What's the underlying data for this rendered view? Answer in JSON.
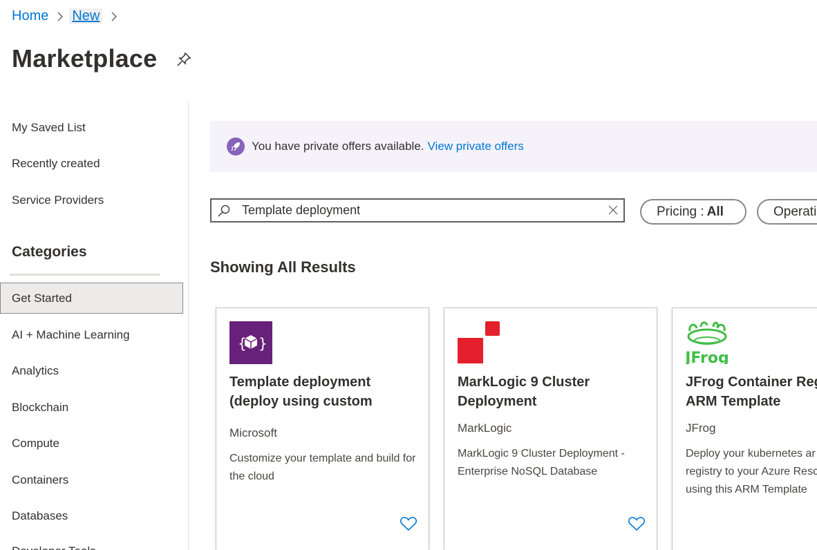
{
  "breadcrumb": {
    "home": "Home",
    "current": "New"
  },
  "page": {
    "title": "Marketplace"
  },
  "sidebar": {
    "top_items": [
      "My Saved List",
      "Recently created",
      "Service Providers"
    ],
    "categories_heading": "Categories",
    "categories": [
      "Get Started",
      "AI + Machine Learning",
      "Analytics",
      "Blockchain",
      "Compute",
      "Containers",
      "Databases",
      "Developer Tools"
    ],
    "selected_category": "Get Started"
  },
  "banner": {
    "text": "You have private offers available.",
    "link": "View private offers"
  },
  "search": {
    "value": "Template deployment",
    "placeholder": ""
  },
  "filters": {
    "pricing_label": "Pricing :",
    "pricing_value": "All",
    "operating_label": "Operati"
  },
  "results": {
    "heading": "Showing All Results",
    "cards": [
      {
        "title": "Template deployment (deploy using custom",
        "publisher": "Microsoft",
        "description": "Customize your template and build for the cloud",
        "logo": "template-logo-icon"
      },
      {
        "title": "MarkLogic 9 Cluster Deployment",
        "publisher": "MarkLogic",
        "description": "MarkLogic 9 Cluster Deployment - Enterprise NoSQL Database",
        "logo": "marklogic-logo-icon"
      },
      {
        "title": "JFrog Container Reg ARM Template",
        "publisher": "JFrog",
        "description": "Deploy your kubernetes ar registry to your Azure Resc using this ARM Template",
        "logo": "jfrog-logo-icon"
      }
    ]
  },
  "colors": {
    "accent": "#0078d4",
    "banner_bg": "#f5f2fa",
    "banner_icon": "#8764b8",
    "template_logo": "#68217a",
    "marklogic_red": "#e3202b",
    "jfrog_green": "#40be46"
  }
}
